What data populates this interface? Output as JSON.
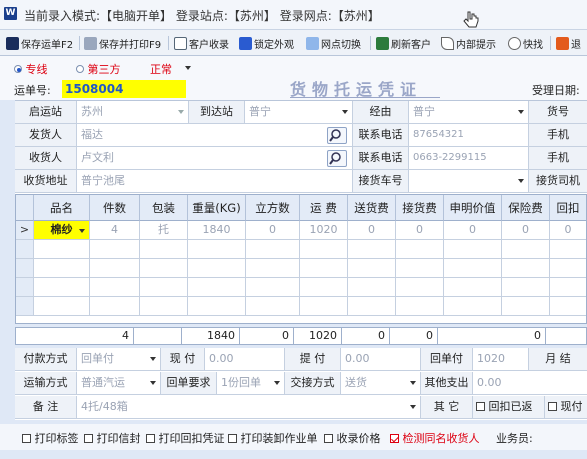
{
  "titlebar": {
    "text": "当前录入模式:【电脑开单】 登录站点:【苏州】 登录网点:【苏州】",
    "icon": "app-logo-icon"
  },
  "toolbar": [
    {
      "label": "保存运单F2",
      "icon": "save-icon"
    },
    {
      "label": "保存并打印F9",
      "icon": "print-icon"
    },
    {
      "label": "客户收录",
      "icon": "customer-edit-icon"
    },
    {
      "label": "锁定外观",
      "icon": "lock-icon"
    },
    {
      "label": "网点切换",
      "icon": "switch-icon"
    },
    {
      "label": "刷新客户",
      "icon": "refresh-icon"
    },
    {
      "label": "内部提示",
      "icon": "pen-icon"
    },
    {
      "label": "快找",
      "icon": "search-icon"
    },
    {
      "label": "退",
      "icon": "exit-icon"
    }
  ],
  "options": {
    "r1": "专线",
    "r2": "第三方",
    "status": "正常"
  },
  "header": {
    "bill_label": "运单号:",
    "bill_no": "1508004",
    "title": "货物托运凭证",
    "accept_date_label": "受理日期:"
  },
  "form": {
    "origin_label": "启运站",
    "origin": "苏州",
    "dest_label": "到达站",
    "dest": "普宁",
    "via_label": "经由",
    "via": "普宁",
    "goods_no_label": "货号",
    "sender_label": "发货人",
    "sender": "福达",
    "sender_phone_label": "联系电话",
    "sender_phone": "87654321",
    "mobile_label1": "手机",
    "receiver_label": "收货人",
    "receiver": "卢文利",
    "receiver_phone_label": "联系电话",
    "receiver_phone": "0663-2299115",
    "mobile_label2": "手机",
    "address_label": "收货地址",
    "address": "普宁池尾",
    "vehicle_label": "接货车号",
    "driver_label": "接货司机"
  },
  "grid": {
    "columns": [
      "品名",
      "件数",
      "包装",
      "重量(KG)",
      "立方数",
      "运 费",
      "送货费",
      "接货费",
      "申明价值",
      "保险费",
      "回扣"
    ],
    "rows": [
      [
        "棉纱",
        "4",
        "托",
        "1840",
        "0",
        "1020",
        "0",
        "0",
        "0",
        "0",
        "0"
      ]
    ],
    "row_marker": ">",
    "totals": [
      "4",
      "1840",
      "0",
      "1020",
      "0",
      "0",
      "0"
    ]
  },
  "bottom": {
    "pay_label": "付款方式",
    "pay": "回单付",
    "cash_label": "现  付",
    "cash": "0.00",
    "pickup_label": "提  付",
    "pickup": "0.00",
    "return_pay_label": "回单付",
    "return_pay": "1020",
    "monthly_label": "月  结",
    "transport_label": "运输方式",
    "transport": "普通汽运",
    "return_req_label": "回单要求",
    "return_req": "1份回单",
    "handover_label": "交接方式",
    "handover": "送货",
    "other_exp_label": "其他支出",
    "other_exp": "0.00",
    "remark_label": "备  注",
    "remark": "4托/48箱",
    "other_label": "其  它",
    "return_done_label": "回扣已返",
    "cashpay_label": "现付"
  },
  "footer": {
    "cb1": "打印标签",
    "cb2": "打印信封",
    "cb3": "打印回扣凭证",
    "cb4": "打印装卸作业单",
    "cb5": "收录价格",
    "cb6": "检测同名收货人",
    "salesman_label": "业务员:"
  }
}
